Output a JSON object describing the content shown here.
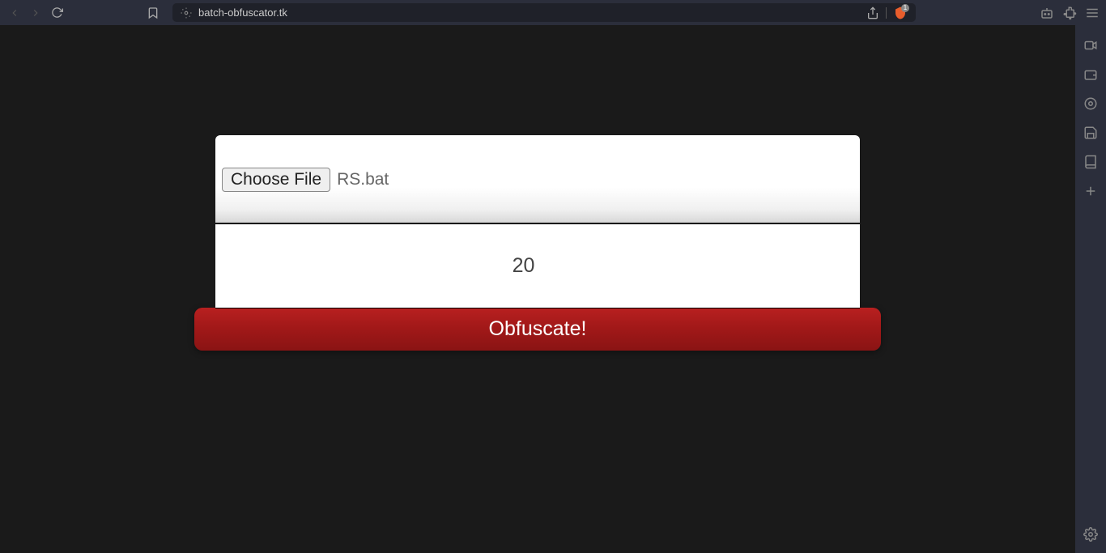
{
  "browser": {
    "url": "batch-obfuscator.tk",
    "shield_count": "1"
  },
  "page": {
    "choose_file_label": "Choose File",
    "selected_file": "RS.bat",
    "iterations_value": "20",
    "obfuscate_label": "Obfuscate!"
  }
}
